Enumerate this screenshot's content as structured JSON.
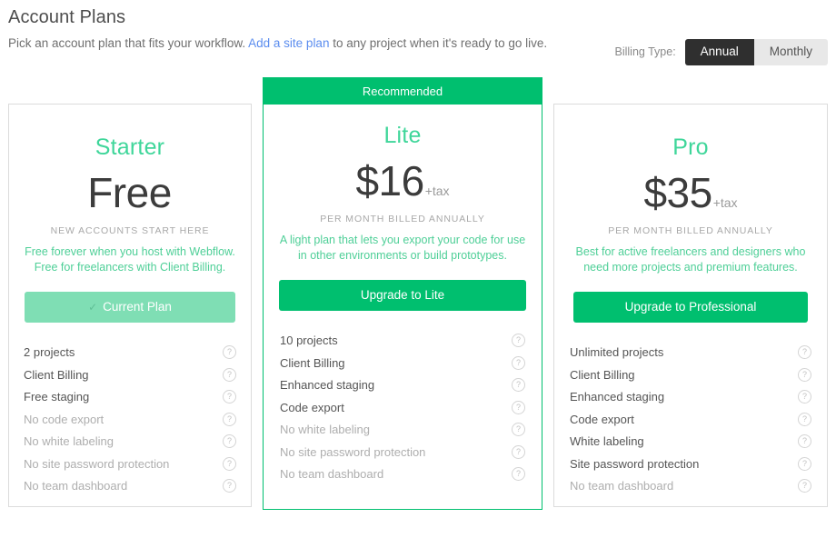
{
  "header": {
    "title": "Account Plans",
    "subtitle_before": "Pick an account plan that fits your workflow. ",
    "subtitle_link": "Add a site plan",
    "subtitle_after": " to any project when it's ready to go live."
  },
  "billing": {
    "label": "Billing Type:",
    "options": [
      "Annual",
      "Monthly"
    ],
    "selected": "Annual",
    "annual_label": "Annual",
    "monthly_label": "Monthly"
  },
  "colors": {
    "brand_green": "#00bf6f",
    "title_green": "#3fd69a",
    "desc_green": "#4ecf97",
    "current_plan_green": "#7fdeb4",
    "link_blue": "#5b8def",
    "toggle_active_bg": "#2f2f2f",
    "toggle_inactive_bg": "#e8e8e8",
    "card_border": "#dcdcdc"
  },
  "plans": [
    {
      "name": "Starter",
      "price": "Free",
      "price_suffix": "",
      "price_note": "NEW ACCOUNTS START HERE",
      "description": "Free forever when you host with Webflow. Free for freelancers with Client Billing.",
      "cta_label": "Current Plan",
      "cta_state": "current",
      "cta_icon": "check-icon",
      "recommended": false,
      "features": [
        {
          "label": "2 projects",
          "enabled": true,
          "help": "help-icon"
        },
        {
          "label": "Client Billing",
          "enabled": true,
          "help": "help-icon"
        },
        {
          "label": "Free staging",
          "enabled": true,
          "help": "help-icon"
        },
        {
          "label": "No code export",
          "enabled": false,
          "help": "help-icon"
        },
        {
          "label": "No white labeling",
          "enabled": false,
          "help": "help-icon"
        },
        {
          "label": "No site password protection",
          "enabled": false,
          "help": "help-icon"
        },
        {
          "label": "No team dashboard",
          "enabled": false,
          "help": "help-icon"
        }
      ]
    },
    {
      "name": "Lite",
      "price": "$16",
      "price_suffix": "+tax",
      "price_note": "PER MONTH BILLED ANNUALLY",
      "description": "A light plan that lets you export your code for use in other environments or build prototypes.",
      "cta_label": "Upgrade to Lite",
      "cta_state": "primary",
      "recommended": true,
      "ribbon_label": "Recommended",
      "features": [
        {
          "label": "10 projects",
          "enabled": true,
          "help": "help-icon"
        },
        {
          "label": "Client Billing",
          "enabled": true,
          "help": "help-icon"
        },
        {
          "label": "Enhanced staging",
          "enabled": true,
          "help": "help-icon"
        },
        {
          "label": "Code export",
          "enabled": true,
          "help": "help-icon"
        },
        {
          "label": "No white labeling",
          "enabled": false,
          "help": "help-icon"
        },
        {
          "label": "No site password protection",
          "enabled": false,
          "help": "help-icon"
        },
        {
          "label": "No team dashboard",
          "enabled": false,
          "help": "help-icon"
        }
      ]
    },
    {
      "name": "Pro",
      "price": "$35",
      "price_suffix": "+tax",
      "price_note": "PER MONTH BILLED ANNUALLY",
      "description": "Best for active freelancers and designers who need more projects and premium features.",
      "cta_label": "Upgrade to Professional",
      "cta_state": "primary",
      "recommended": false,
      "features": [
        {
          "label": "Unlimited projects",
          "enabled": true,
          "help": "help-icon"
        },
        {
          "label": "Client Billing",
          "enabled": true,
          "help": "help-icon"
        },
        {
          "label": "Enhanced staging",
          "enabled": true,
          "help": "help-icon"
        },
        {
          "label": "Code export",
          "enabled": true,
          "help": "help-icon"
        },
        {
          "label": "White labeling",
          "enabled": true,
          "help": "help-icon"
        },
        {
          "label": "Site password protection",
          "enabled": true,
          "help": "help-icon"
        },
        {
          "label": "No team dashboard",
          "enabled": false,
          "help": "help-icon"
        }
      ]
    }
  ],
  "icons": {
    "help": "?",
    "check": "✓"
  }
}
